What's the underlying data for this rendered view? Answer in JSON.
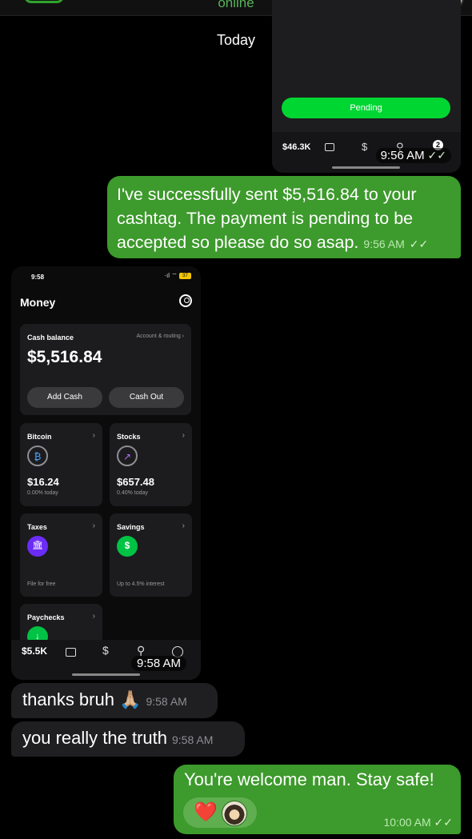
{
  "header": {
    "status": "online"
  },
  "date_chip": "Today",
  "shared_screenshot_out": {
    "button_label": "Pending",
    "balance": "$46.3K",
    "badge": "2",
    "dollar_icon": "$",
    "search_icon": "⚲",
    "time": "9:56 AM"
  },
  "messages": [
    {
      "id": "m1",
      "text": "I've successfully sent $5,516.84 to your cashtag. The payment is pending to be accepted so please do so asap.",
      "time": "9:56 AM",
      "tick": "✓✓"
    },
    {
      "id": "m2",
      "text": "thanks bruh 🙏🏼",
      "time": "9:58 AM"
    },
    {
      "id": "m3",
      "text": "you really the truth",
      "time": "9:58 AM"
    },
    {
      "id": "m4",
      "text": "You're welcome man. Stay safe!",
      "time": "10:00 AM",
      "tick": "✓✓",
      "reaction": "❤️"
    }
  ],
  "shared_screenshot_in": {
    "status_time": "9:58",
    "signal": "·ıl ⌔",
    "battery": "37",
    "title": "Money",
    "cash_card": {
      "label": "Cash balance",
      "account_link": "Account & routing  ›",
      "amount": "$5,516.84",
      "add_cash": "Add Cash",
      "cash_out": "Cash Out"
    },
    "tiles": [
      {
        "label": "Bitcoin",
        "value": "$16.24",
        "sub": "0.00% today",
        "icon": "₿"
      },
      {
        "label": "Stocks",
        "value": "$657.48",
        "sub": "0.40% today",
        "icon": "↗"
      },
      {
        "label": "Taxes",
        "sub": "File for free",
        "icon": "🏛"
      },
      {
        "label": "Savings",
        "sub": "Up to 4.5% interest",
        "icon": "$"
      },
      {
        "label": "Paychecks",
        "icon": "↓"
      }
    ],
    "bottom_bar": {
      "balance": "$5.5K",
      "dollar_icon": "$",
      "search_icon": "⚲"
    },
    "time": "9:58 AM"
  },
  "colors": {
    "bubble_out": "#3d9a2c",
    "bubble_in": "#1f1f21",
    "cash_green": "#00d632",
    "taxes_purple": "#6b2cf5",
    "savings_green": "#00c244"
  }
}
